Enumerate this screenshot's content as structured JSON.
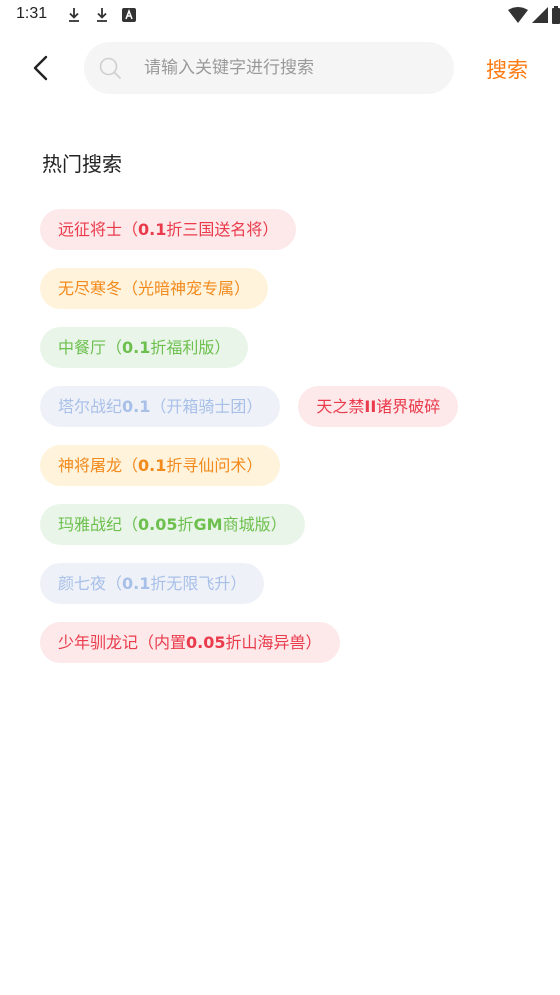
{
  "status_bar": {
    "time": "1:31",
    "left_icons": [
      "download-icon",
      "download-icon",
      "a-badge-icon"
    ],
    "right_icons": [
      "wifi-icon",
      "signal-icon",
      "battery-icon"
    ]
  },
  "header": {
    "back_icon": "chevron-left-icon",
    "search_icon": "search-icon",
    "search_placeholder": "请输入关键字进行搜索",
    "search_value": "",
    "search_button": "搜索",
    "accent_color": "#ff7a12"
  },
  "hot": {
    "title": "热门搜索",
    "tags": [
      {
        "text": "远征将士（0.1折三国送名将）",
        "color": "red"
      },
      {
        "text": "无尽寒冬（光暗神宠专属）",
        "color": "orange"
      },
      {
        "text": "中餐厅（0.1折福利版）",
        "color": "green"
      },
      {
        "text": "塔尔战纪0.1（开箱骑士团）",
        "color": "blue"
      },
      {
        "text": "天之禁II诸界破碎",
        "color": "red"
      },
      {
        "text": "神将屠龙（0.1折寻仙问术）",
        "color": "orange"
      },
      {
        "text": "玛雅战纪（0.05折GM商城版）",
        "color": "green"
      },
      {
        "text": "颜七夜（0.1折无限飞升）",
        "color": "blue"
      },
      {
        "text": "少年驯龙记（内置0.05折山海异兽）",
        "color": "red"
      }
    ]
  },
  "colors": {
    "red": {
      "bg": "#fde8ea",
      "fg": "#ea3b4c"
    },
    "orange": {
      "bg": "#fff3dc",
      "fg": "#f28a1c"
    },
    "green": {
      "bg": "#eaf5ea",
      "fg": "#6dc04e"
    },
    "blue": {
      "bg": "#eef1f8",
      "fg": "#a8c0e8"
    }
  }
}
